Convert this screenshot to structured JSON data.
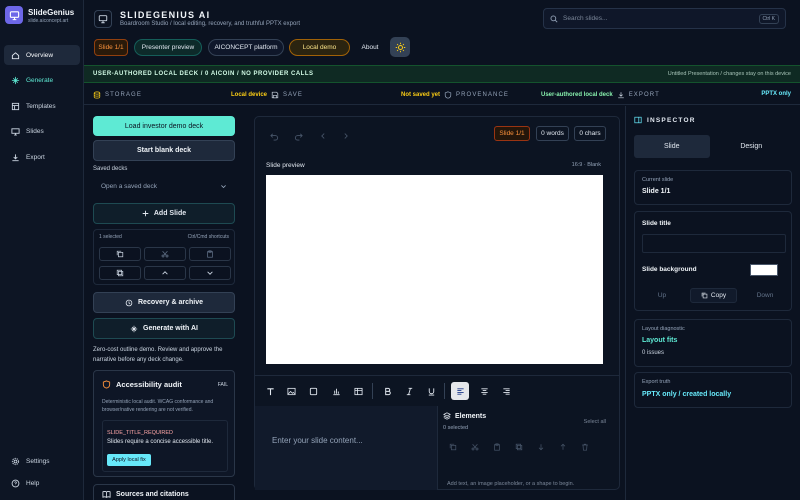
{
  "brand": {
    "name": "SlideGenius",
    "url": "slide.aiconcept.art"
  },
  "nav": {
    "items": [
      {
        "label": "Overview",
        "icon": "home-icon"
      },
      {
        "label": "Generate",
        "icon": "sparkle-icon"
      },
      {
        "label": "Templates",
        "icon": "templates-icon"
      },
      {
        "label": "Slides",
        "icon": "slides-icon"
      },
      {
        "label": "Export",
        "icon": "export-icon"
      }
    ],
    "settings_label": "Settings",
    "help_label": "Help"
  },
  "header": {
    "title": "SLIDEGENIUS AI",
    "subtitle": "Boardroom Studio / local editing, recovery, and truthful PPTX export",
    "search_placeholder": "Search slides...",
    "search_shortcut": "Ctrl K",
    "chips": {
      "slide": "Slide 1/1",
      "presenter": "Presenter preview",
      "platform": "AICONCEPT platform",
      "local_demo": "Local demo",
      "about": "About"
    }
  },
  "banner": {
    "left": "USER-AUTHORED LOCAL DECK / 0 AICOIN / NO PROVIDER CALLS",
    "right": "Untitled Presentation / changes stay on this device"
  },
  "status": {
    "storage_label": "STORAGE",
    "storage_value": "Local device",
    "save_label": "SAVE",
    "save_value": "Not saved yet",
    "provenance_label": "PROVENANCE",
    "provenance_value": "User-authored local deck",
    "export_label": "EXPORT",
    "export_value": "PPTX only"
  },
  "left": {
    "load_demo": "Load investor demo deck",
    "start_blank": "Start blank deck",
    "saved_label": "Saved decks",
    "saved_placeholder": "Open a saved deck",
    "add_slide": "Add Slide",
    "selected_info": "1 selected",
    "shortcut_hint": "Ctrl/Cmd shortcuts",
    "recovery": "Recovery & archive",
    "generate_ai": "Generate with AI",
    "hint": "Zero-cost outline demo. Review and approve the narrative before any deck change.",
    "a11y": {
      "title": "Accessibility audit",
      "status": "FAIL",
      "desc": "Deterministic local audit. WCAG conformance and browser/native rendering are not verified.",
      "issue_code": "SLIDE_TITLE_REQUIRED",
      "issue_msg": "Slides require a concise accessible title.",
      "fix": "Apply local fix"
    },
    "sources": "Sources and citations"
  },
  "editor": {
    "slide_pill": "Slide 1/1",
    "words_pill": "0 words",
    "chars_pill": "0 chars",
    "preview_label": "Slide preview",
    "preview_meta": "16:9 · Blank",
    "content_placeholder": "Enter your slide content...",
    "elements_title": "Elements",
    "elements_count": "0 selected",
    "select_all": "Select all",
    "elements_hint": "Add text, an image placeholder, or a shape to begin."
  },
  "inspector": {
    "title": "INSPECTOR",
    "tabs": [
      "Slide",
      "Design"
    ],
    "current_slide_label": "Current slide",
    "current_slide_value": "Slide 1/1",
    "slide_title_label": "Slide title",
    "slide_title_value": "",
    "bg_label": "Slide background",
    "up": "Up",
    "copy": "Copy",
    "down": "Down",
    "layout_label": "Layout diagnostic",
    "layout_value": "Layout fits",
    "layout_sub": "0 issues",
    "export_label": "Export truth",
    "export_value": "PPTX only / created locally"
  },
  "colors": {
    "accent_teal": "#5eead4",
    "accent_cyan": "#67e8f9",
    "warning_yellow": "#facc15",
    "brand_purple": "#6d67e8",
    "slide_bg": "#ffffff"
  }
}
